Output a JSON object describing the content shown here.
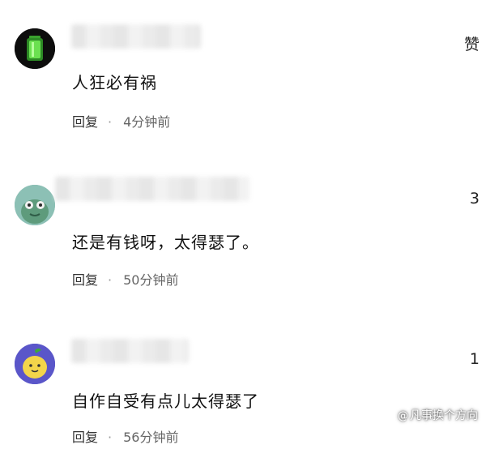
{
  "comments": [
    {
      "text": "人狂必有祸",
      "like": "赞",
      "reply_label": "回复",
      "separator": "·",
      "time": "4分钟前",
      "avatar_icon": "green-battery-avatar-icon"
    },
    {
      "text": "还是有钱呀，太得瑟了。",
      "like": "3",
      "reply_label": "回复",
      "separator": "·",
      "time": "50分钟前",
      "avatar_icon": "green-creature-avatar-icon"
    },
    {
      "text": "自作自受有点儿太得瑟了",
      "like": "1",
      "reply_label": "回复",
      "separator": "·",
      "time": "56分钟前",
      "avatar_icon": "yellow-fruit-avatar-icon"
    }
  ],
  "watermark": {
    "prefix": "@",
    "text": "凡事换个方向"
  },
  "colors": {
    "avatar1_bg": "#0d0d0d",
    "avatar1_accent": "#4ccb3c",
    "avatar2_bg": "#7fb1a8",
    "avatar3_bg": "#5a56c9",
    "avatar3_fruit": "#f3d54a"
  }
}
